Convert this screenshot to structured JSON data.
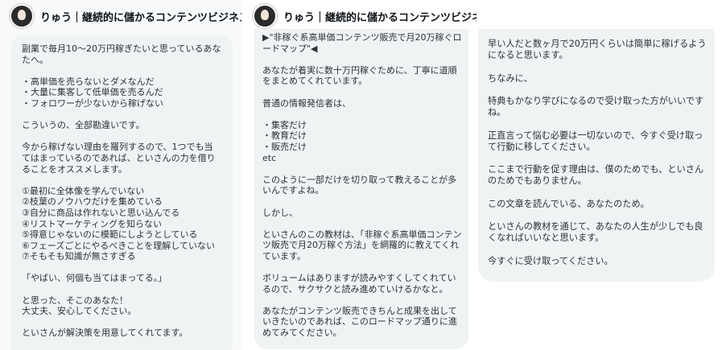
{
  "author_name": "りゅう｜継続的に儲かるコンテンツビジネス構築屋",
  "panel_1": {
    "header_name": "りゅう｜継続的に儲かるコンテンツビジネス構築",
    "message": "副業で毎月10〜20万円稼ぎたいと思っているあなたへ。\n\n・高単価を売らないとダメなんだ\n・大量に集客して低単価を売るんだ\n・フォロワーが少ないから稼げない\n\nこういうの、全部勘違いです。\n\n今から稼げない理由を羅列するので、1つでも当てはまっているのであれば、といさんの力を借りることをオススメします。\n\n①最初に全体像を学んでいない\n②枝葉のノウハウだけを集めている\n③自分に商品は作れないと思い込んでる\n④リストマーケティングを知らない\n⑤得意じゃないのに模範にしようとしている\n⑥フェーズごとにやるべきことを理解していない\n⑦そもそも知識が無さすぎる\n\n「やばい、何個も当てはまってる。」\n\nと思った、そこのあなた！\n大丈夫、安心してください。\n\nといさんが解決策を用意してくれてます。"
  },
  "panel_2": {
    "header_name": "りゅう｜継続的に儲かるコンテンツビジネス構築屋｜",
    "message": "▶\"非稼ぐ系高単価コンテンツ販売で月20万稼ぐロードマップ\"◀\n\nあなたが着実に数十万円稼ぐために、丁寧に道順をまとめてくれています。\n\n普通の情報発信者は、\n\n・集客だけ\n・教育だけ\n・販売だけ\netc\n\nこのように一部だけを切り取って教えることが多いんですよね。\n\nしかし、\n\nといさんのこの教材は、「非稼ぐ系高単価コンテンツ販売で月20万稼ぐ方法」を網羅的に教えてくれています。\n\nボリュームはありますが読みやすくしてくれているので、サクサクと読み進めていけるかなと。\n\nあなたがコンテンツ販売できちんと成果を出していきたいのであれば、このロードマップ通りに進めてみてください。"
  },
  "panel_3": {
    "message": "早い人だと数ヶ月で20万円くらいは簡単に稼げるようになると思います。\n\nちなみに、\n\n特典もかなり学びになるので受け取った方がいいですね。\n\n正直言って悩む必要は一切ないので、今すぐ受け取って行動に移してください。\n\nここまで行動を促す理由は、僕のためでも、といさんのためでもありません。\n\nこの文章を読んでいる、あなたのため。\n\nといさんの教材を通じて、あなたの人生が少しでも良くなればいいなと思います。\n\n今すぐに受け取ってください。"
  },
  "icons": {
    "verified": "verified-badge-icon",
    "verified_glyph": "✓"
  },
  "colors": {
    "bubble": "#eff3f4",
    "verified": "#1d9bf0",
    "text": "#2a3137"
  }
}
